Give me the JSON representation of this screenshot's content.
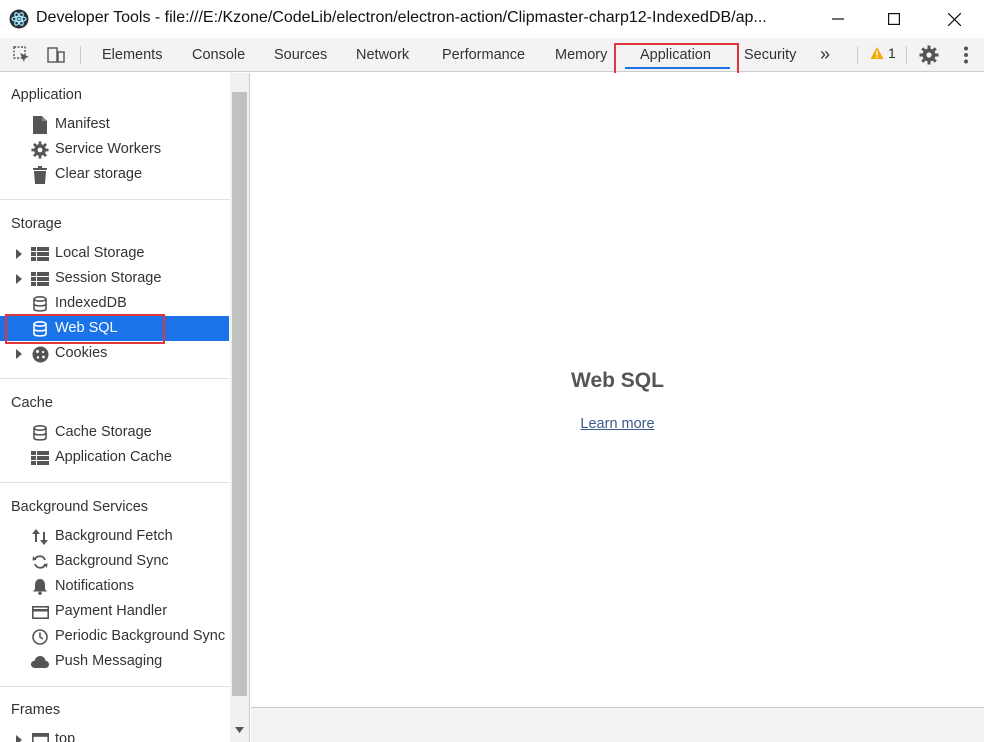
{
  "window": {
    "title": "Developer Tools - file:///E:/Kzone/CodeLib/electron/electron-action/Clipmaster-charp12-IndexedDB/ap..."
  },
  "toolbar": {
    "tabs": [
      "Elements",
      "Console",
      "Sources",
      "Network",
      "Performance",
      "Memory",
      "Application",
      "Security"
    ],
    "active_tab": "Application",
    "more_label": "»",
    "warning_count": "1"
  },
  "sidebar": {
    "sections": {
      "application": {
        "title": "Application",
        "items": [
          "Manifest",
          "Service Workers",
          "Clear storage"
        ]
      },
      "storage": {
        "title": "Storage",
        "items": [
          "Local Storage",
          "Session Storage",
          "IndexedDB",
          "Web SQL",
          "Cookies"
        ]
      },
      "cache": {
        "title": "Cache",
        "items": [
          "Cache Storage",
          "Application Cache"
        ]
      },
      "background": {
        "title": "Background Services",
        "items": [
          "Background Fetch",
          "Background Sync",
          "Notifications",
          "Payment Handler",
          "Periodic Background Sync",
          "Push Messaging"
        ]
      },
      "frames": {
        "title": "Frames",
        "items": [
          "top"
        ]
      }
    },
    "selected_item": "Web SQL"
  },
  "main": {
    "title": "Web SQL",
    "link_text": "Learn more"
  },
  "colors": {
    "accent": "#1a73e8",
    "highlight_box": "#e0353a",
    "warning": "#f2a900"
  }
}
